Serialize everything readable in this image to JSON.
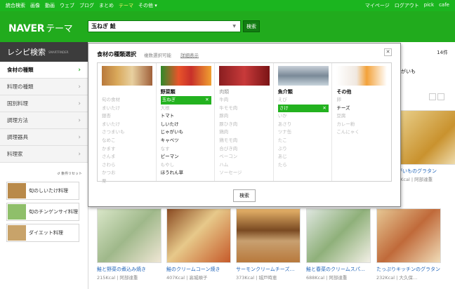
{
  "topnav": {
    "left": [
      "統合検索",
      "画像",
      "動画",
      "ウェブ",
      "ブログ",
      "まとめ",
      "テーマ",
      "その他 ▾"
    ],
    "right": [
      "マイページ",
      "ログアウト",
      "pick",
      "cafe"
    ]
  },
  "header": {
    "logo": "NAVER",
    "logo_suffix": "テーマ",
    "query": "玉ねぎ 鮭",
    "search_label": "検索"
  },
  "sidebar": {
    "title": "レシピ検索",
    "title_sub": "SMARTFINDER",
    "items": [
      {
        "label": "食材の種類"
      },
      {
        "label": "料理の種類"
      },
      {
        "label": "国別料理"
      },
      {
        "label": "調理方法"
      },
      {
        "label": "調理器具"
      },
      {
        "label": "料理家"
      }
    ],
    "reset": "条件リセット",
    "recent": [
      "旬のしいたけ料理",
      "旬のチンゲンサイ料理",
      "ダイエット料理"
    ]
  },
  "results": {
    "count": "14件",
    "partial_title": "がいも",
    "cards_top": [
      {
        "title": "",
        "meta": ""
      },
      {
        "title": "ジャガイモとサーモンのグラタン",
        "meta": "…Kcal | 阿部達…"
      }
    ],
    "cards": [
      {
        "title": "鮭と野菜の煮込み焼き",
        "meta": "215Kcal | 阿部達重"
      },
      {
        "title": "鮭のクリームコーン焼き",
        "meta": "407Kcal | 高城順子"
      },
      {
        "title": "サーモンクリームチーズ…",
        "meta": "373Kcal | 城戸時恵"
      },
      {
        "title": "鮭と春菜のクリームスパ…",
        "meta": "688Kcal | 阿部達重"
      },
      {
        "title": "たっぷりキッチンのグラタン",
        "meta": "232Kcal | 大久保…"
      }
    ],
    "top_cards": [
      {
        "title": "がいものグラタン",
        "meta": "3Kcal | 阿部達重"
      }
    ]
  },
  "modal": {
    "title": "食材の種類選択",
    "option": "複数選択可能",
    "detail": "詳細表示",
    "search": "検索",
    "columns": [
      {
        "header": "",
        "items": [
          "旬の食材",
          "まいたけ",
          "銀杏",
          "まいたけ",
          "さつまいも",
          "なめこ",
          "かます",
          "さんま",
          "さわら",
          "かつお",
          "栗"
        ],
        "dim": true
      },
      {
        "header": "野菜類",
        "items": [
          "玉ねぎ",
          "大根",
          "トマト",
          "しいたけ",
          "じゃがいも",
          "キャベツ",
          "なす",
          "ピーマン",
          "もやし",
          "ほうれん草"
        ],
        "selected": 0,
        "on": [
          2,
          3,
          4,
          5,
          7,
          9
        ]
      },
      {
        "header": "肉類",
        "items": [
          "牛肉",
          "牛モモ肉",
          "豚肉",
          "豚ひき肉",
          "鶏肉",
          "鶏モモ肉",
          "合びき肉",
          "ベーコン",
          "ハム",
          "ソーセージ"
        ],
        "dim": true
      },
      {
        "header": "魚介類",
        "items": [
          "えび",
          "さけ",
          "いか",
          "あさり",
          "ツナ缶",
          "たこ",
          "ぶり",
          "あじ",
          "たら"
        ],
        "selected": 1
      },
      {
        "header": "その他",
        "items": [
          "卵",
          "チーズ",
          "豆腐",
          "カレー粉",
          "こんにゃく"
        ],
        "on": [
          1
        ]
      }
    ]
  },
  "colors": {
    "brand": "#21ab1d",
    "topbar": "#1bb51f",
    "active_tab": "#fff36d"
  }
}
